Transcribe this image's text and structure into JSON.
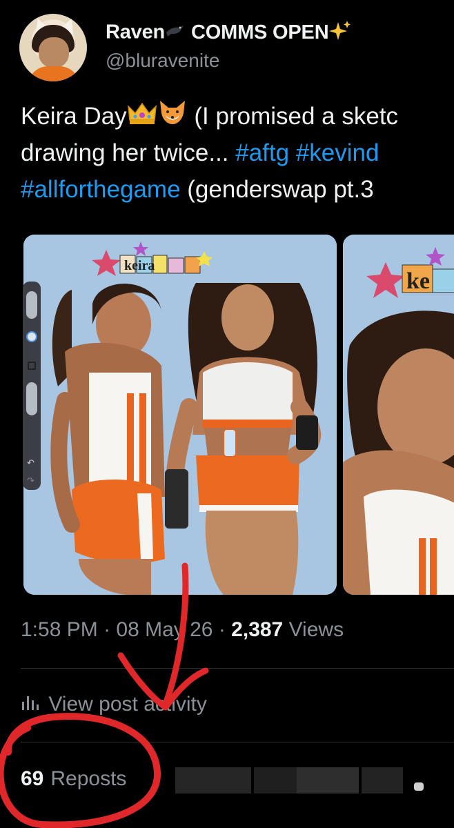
{
  "author": {
    "display_name": "Raven",
    "name_suffix": "COMMS OPEN",
    "handle": "@bluravenite",
    "icons": [
      "crow-icon",
      "sparkles-icon"
    ]
  },
  "tweet": {
    "line1_text": "Keira Day",
    "line1_tail": " (I promised a sketc",
    "line2_text": "drawing her twice... ",
    "line2_tag1": "#aftg",
    "line2_tag2": "#kevind",
    "line3_tag": "#allforthegame",
    "line3_tail": " (genderswap pt.3",
    "emoji_icons": [
      "crown-icon",
      "fox-face-icon"
    ]
  },
  "media": {
    "image1_label": "keira",
    "image2_label": "ke"
  },
  "meta": {
    "time": "1:58 PM",
    "sep1": " · ",
    "date": "08 May 26",
    "sep2": " · ",
    "views_count": "2,387",
    "views_label": " Views"
  },
  "activity": {
    "label": "View post activity",
    "icon": "bar-chart-icon"
  },
  "reposts": {
    "count": "69",
    "label": "Reposts"
  },
  "colors": {
    "background": "#000000",
    "text": "#eef0f1",
    "muted": "#8b9198",
    "link": "#1d9bf0",
    "annotation": "#e0282a"
  }
}
